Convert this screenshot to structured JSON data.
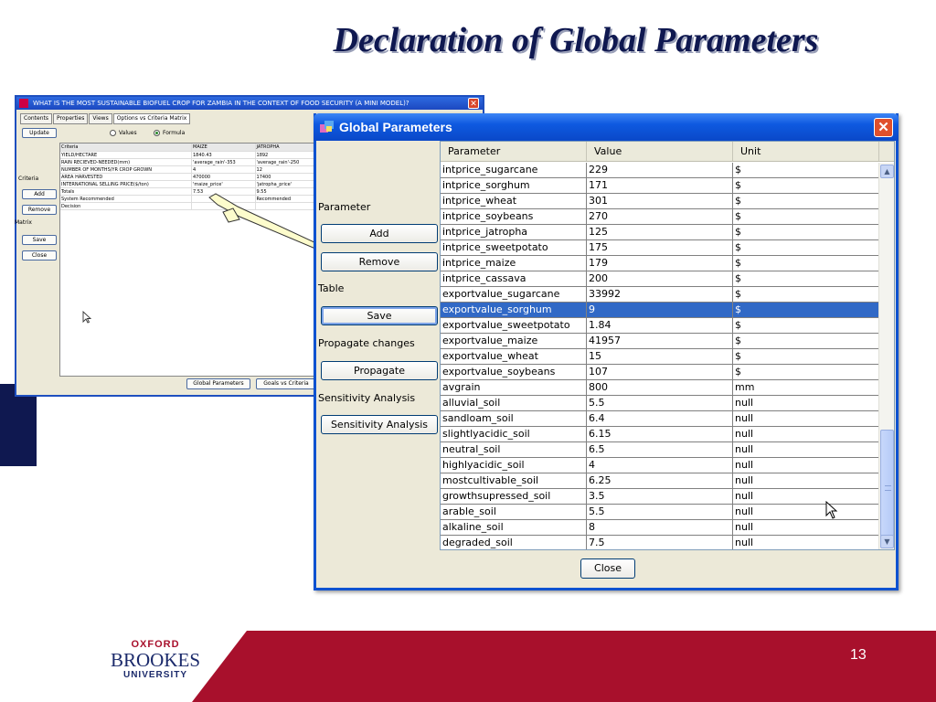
{
  "slide": {
    "title": "Declaration of Global Parameters",
    "slide_number": "13"
  },
  "logo": {
    "line1": "OXFORD",
    "line2": "BROOKES",
    "line3": "UNIVERSITY"
  },
  "background_window": {
    "title": "WHAT IS THE MOST SUSTAINABLE BIOFUEL CROP FOR ZAMBIA IN THE CONTEXT OF FOOD SECURITY (A MINI MODEL)?",
    "tabs": [
      "Contents",
      "Properties",
      "Views",
      "Options vs Criteria Matrix"
    ],
    "update_label": "Update",
    "radio_values": "Values",
    "radio_formula": "Formula",
    "criteria_label": "Criteria",
    "add_label": "Add",
    "remove_label": "Remove",
    "matrix_label": "Matrix",
    "save_label": "Save",
    "close_label": "Close",
    "table_headers": [
      "Criteria",
      "MAIZE",
      "JATROPHA"
    ],
    "table_rows": [
      [
        "YIELD/HECTARE",
        "1840.43",
        "1892"
      ],
      [
        "RAIN RECIEVED-NEEDED(mm)",
        "'average_rain'-353",
        "'average_rain'-250"
      ],
      [
        "NUMBER OF MONTHS/YR CROP GROWN",
        "4",
        "12"
      ],
      [
        "AREA HARVESTED",
        "470000",
        "17400"
      ],
      [
        "INTERNATIONAL SELLING PRICE($/ton)",
        "'maize_price'",
        "'jatropha_price'"
      ],
      [
        "Totals",
        "7.53",
        "9.55"
      ],
      [
        "System Recommended",
        "",
        "Recommended"
      ],
      [
        "Decision",
        "",
        ""
      ]
    ],
    "footer_buttons": [
      "Global Parameters",
      "Goals vs Criteria"
    ]
  },
  "dialog": {
    "title": "Global Parameters",
    "sections": {
      "parameter": "Parameter",
      "table": "Table",
      "propagate_changes": "Propagate changes",
      "sensitivity": "Sensitivity Analysis"
    },
    "buttons": {
      "add": "Add",
      "remove": "Remove",
      "save": "Save",
      "propagate": "Propagate",
      "sensitivity": "Sensitivity Analysis",
      "close": "Close"
    },
    "columns": [
      "Parameter",
      "Value",
      "Unit"
    ],
    "selected_row_index": 9,
    "rows": [
      [
        "intprice_sugarcane",
        "229",
        "$"
      ],
      [
        "intprice_sorghum",
        "171",
        "$"
      ],
      [
        "intprice_wheat",
        "301",
        "$"
      ],
      [
        "intprice_soybeans",
        "270",
        "$"
      ],
      [
        "intprice_jatropha",
        "125",
        "$"
      ],
      [
        "intprice_sweetpotato",
        "175",
        "$"
      ],
      [
        "intprice_maize",
        "179",
        "$"
      ],
      [
        "intprice_cassava",
        "200",
        "$"
      ],
      [
        "exportvalue_sugarcane",
        "33992",
        "$"
      ],
      [
        "exportvalue_sorghum",
        "9",
        "$"
      ],
      [
        "exportvalue_sweetpotato",
        "1.84",
        "$"
      ],
      [
        "exportvalue_maize",
        "41957",
        "$"
      ],
      [
        "exportvalue_wheat",
        "15",
        "$"
      ],
      [
        "exportvalue_soybeans",
        "107",
        "$"
      ],
      [
        "avgrain",
        "800",
        "mm"
      ],
      [
        "alluvial_soil",
        "5.5",
        "null"
      ],
      [
        "sandloam_soil",
        "6.4",
        "null"
      ],
      [
        "slightlyacidic_soil",
        "6.15",
        "null"
      ],
      [
        "neutral_soil",
        "6.5",
        "null"
      ],
      [
        "highlyacidic_soil",
        "4",
        "null"
      ],
      [
        "mostcultivable_soil",
        "6.25",
        "null"
      ],
      [
        "growthsupressed_soil",
        "3.5",
        "null"
      ],
      [
        "arable_soil",
        "5.5",
        "null"
      ],
      [
        "alkaline_soil",
        "8",
        "null"
      ],
      [
        "degraded_soil",
        "7.5",
        "null"
      ]
    ]
  },
  "colors": {
    "title_navy": "#0f1850",
    "footer_red": "#a8102c",
    "xp_blue": "#0e52d0",
    "selection_blue": "#3169c6"
  }
}
